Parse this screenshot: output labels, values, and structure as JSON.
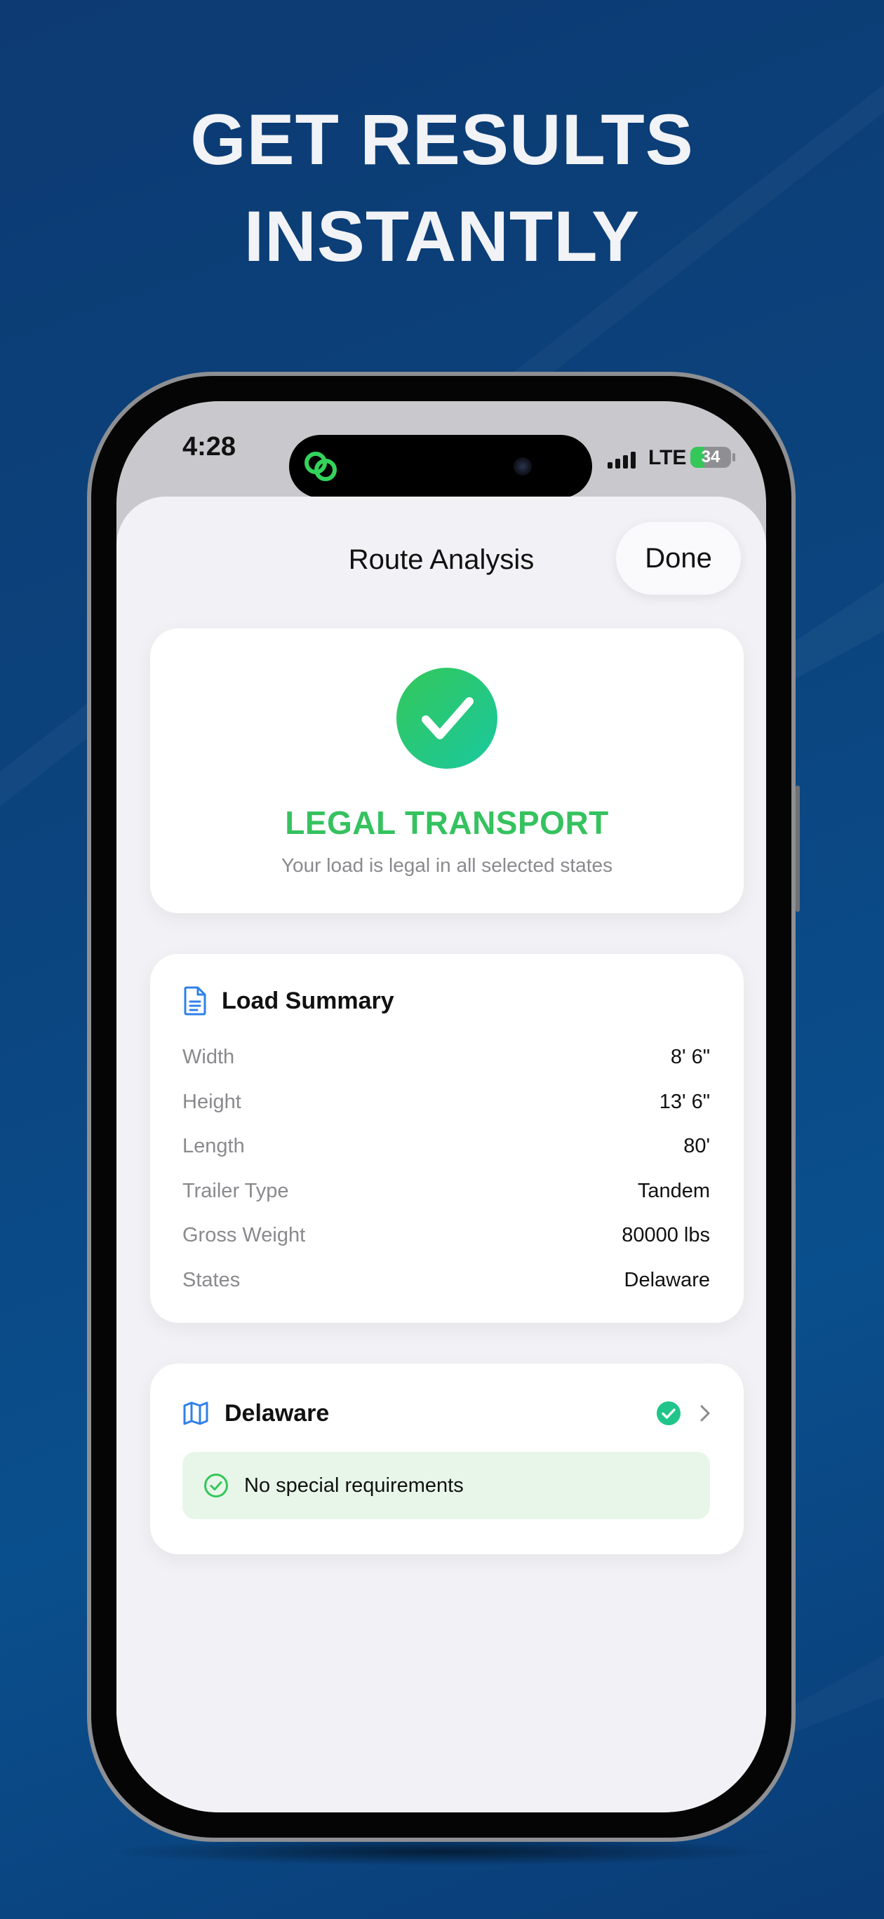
{
  "headline": {
    "line1": "GET RESULTS",
    "line2": "INSTANTLY"
  },
  "status_bar": {
    "time": "4:28",
    "network": "LTE",
    "battery_level": "34",
    "battery_fraction": 0.34
  },
  "nav": {
    "title": "Route Analysis",
    "done_label": "Done"
  },
  "result": {
    "title": "LEGAL TRANSPORT",
    "subtitle": "Your load is legal in all selected states"
  },
  "load_summary": {
    "title": "Load Summary",
    "rows": [
      {
        "label": "Width",
        "value": "8' 6\""
      },
      {
        "label": "Height",
        "value": "13' 6\""
      },
      {
        "label": "Length",
        "value": "80'"
      },
      {
        "label": "Trailer Type",
        "value": "Tandem"
      },
      {
        "label": "Gross Weight",
        "value": "80000 lbs"
      },
      {
        "label": "States",
        "value": "Delaware"
      }
    ]
  },
  "states": [
    {
      "name": "Delaware",
      "requirement": "No special requirements"
    }
  ],
  "colors": {
    "accent_green": "#34c759",
    "teal": "#1ac9a0",
    "icon_blue": "#2f80e8",
    "background_navy": "#0b447e"
  },
  "icons": {
    "document": "document-icon",
    "map": "map-icon",
    "check": "checkmark-icon",
    "chevron": "chevron-right-icon"
  }
}
